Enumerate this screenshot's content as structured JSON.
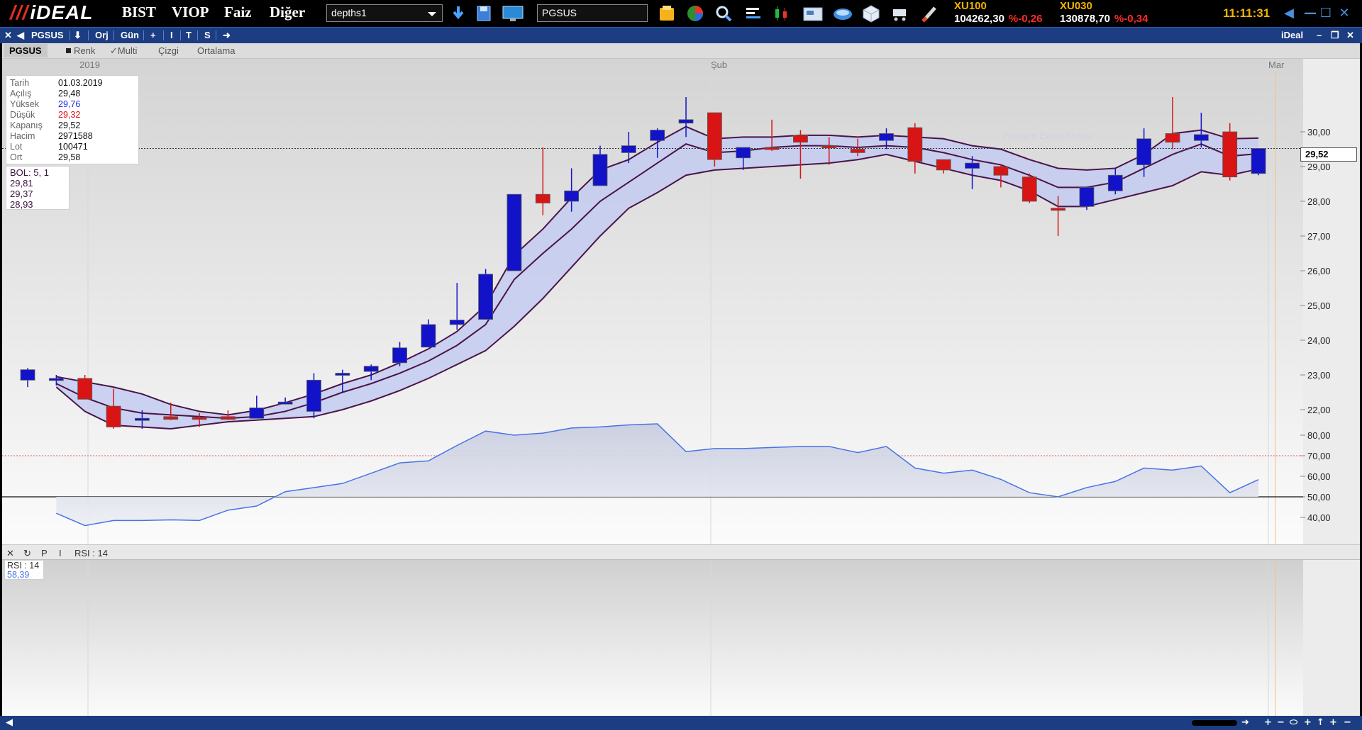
{
  "topbar": {
    "logo": "iDEAL",
    "menu": [
      "BIST",
      "VIOP",
      "Faiz",
      "Diğer"
    ],
    "layout_select": "depths1",
    "symbol_input": "PGSUS",
    "indices": [
      {
        "name": "XU100",
        "value": "104262,30",
        "change": "%-0,26"
      },
      {
        "name": "XU030",
        "value": "130878,70",
        "change": "%-0,34"
      }
    ],
    "clock": "11:11:31",
    "icons": [
      "download-icon",
      "save-icon",
      "monitor-icon",
      "folder-icon",
      "pie-chart-icon",
      "magnifier-icon",
      "depth-icon",
      "candles-icon",
      "news-icon",
      "globe-icon",
      "cube-icon",
      "cart-icon",
      "brush-icon"
    ]
  },
  "titlebar": {
    "symbol": "PGSUS",
    "orj": "Orj",
    "period": "Gün",
    "plus": "+",
    "i": "I",
    "t": "T",
    "s": "S",
    "brand": "iDeal"
  },
  "toolbar": {
    "symbol": "PGSUS",
    "renk": "Renk",
    "multi": "✓Multi",
    "cizgi": "Çizgi",
    "ortalama": "Ortalama"
  },
  "info": {
    "rows": [
      {
        "label": "Tarih",
        "value": "01.03.2019",
        "color": "#111111"
      },
      {
        "label": "Açılış",
        "value": "29,48",
        "color": "#111111"
      },
      {
        "label": "Yüksek",
        "value": "29,76",
        "color": "#1a2ee0"
      },
      {
        "label": "Düşük",
        "value": "29,32",
        "color": "#e01010"
      },
      {
        "label": "Kapanış",
        "value": "29,52",
        "color": "#111111"
      },
      {
        "label": "Hacim",
        "value": "2971588",
        "color": "#111111"
      },
      {
        "label": "Lot",
        "value": "100471",
        "color": "#111111"
      },
      {
        "label": "Ort",
        "value": "29,58",
        "color": "#111111"
      }
    ]
  },
  "bollinger": {
    "title": "BOL: 5, 1",
    "upper": "29,81",
    "mid": "29,37",
    "lower": "28,93"
  },
  "watermark": "Pencere Ekran Alıntısı",
  "last_price": "29,52",
  "rsi": {
    "label": "RSI : 14",
    "box_title": "RSI : 14",
    "value": "58,39",
    "toolbar_icons": [
      "close-icon",
      "refresh-icon",
      "P",
      "I"
    ]
  },
  "colors": {
    "up": "#1212c8",
    "down": "#d81414",
    "band": "#4a1448",
    "band_fill": "#c4cbf0",
    "rsi_line": "#4a72e6"
  },
  "chart_data": {
    "type": "candlestick",
    "symbol": "PGSUS",
    "period_labels": [
      "2019",
      "Şub",
      "Mar"
    ],
    "ylim": [
      21.0,
      31.5
    ],
    "yticks": [
      "22,00",
      "23,00",
      "24,00",
      "25,00",
      "26,00",
      "27,00",
      "28,00",
      "29,00",
      "30,00"
    ],
    "candles": [
      {
        "o": 22.85,
        "h": 23.2,
        "l": 22.65,
        "c": 23.15
      },
      {
        "o": 22.9,
        "h": 23.0,
        "l": 22.7,
        "c": 22.9
      },
      {
        "o": 22.9,
        "h": 23.0,
        "l": 22.35,
        "c": 22.3
      },
      {
        "o": 22.1,
        "h": 22.6,
        "l": 21.45,
        "c": 21.5
      },
      {
        "o": 21.75,
        "h": 21.98,
        "l": 21.45,
        "c": 21.75
      },
      {
        "o": 21.8,
        "h": 22.2,
        "l": 21.7,
        "c": 21.72
      },
      {
        "o": 21.78,
        "h": 21.9,
        "l": 21.5,
        "c": 21.76
      },
      {
        "o": 21.8,
        "h": 21.98,
        "l": 21.7,
        "c": 21.72
      },
      {
        "o": 21.75,
        "h": 22.4,
        "l": 21.75,
        "c": 22.05
      },
      {
        "o": 22.18,
        "h": 22.35,
        "l": 22.15,
        "c": 22.22
      },
      {
        "o": 21.95,
        "h": 23.05,
        "l": 21.75,
        "c": 22.85
      },
      {
        "o": 23.0,
        "h": 23.15,
        "l": 22.5,
        "c": 23.05
      },
      {
        "o": 23.1,
        "h": 23.3,
        "l": 22.85,
        "c": 23.25
      },
      {
        "o": 23.35,
        "h": 23.95,
        "l": 23.25,
        "c": 23.78
      },
      {
        "o": 23.8,
        "h": 24.6,
        "l": 23.8,
        "c": 24.45
      },
      {
        "o": 24.45,
        "h": 25.65,
        "l": 24.3,
        "c": 24.58
      },
      {
        "o": 24.6,
        "h": 26.05,
        "l": 24.6,
        "c": 25.9
      },
      {
        "o": 26.0,
        "h": 28.2,
        "l": 26.0,
        "c": 28.2
      },
      {
        "o": 28.2,
        "h": 29.55,
        "l": 27.6,
        "c": 27.95
      },
      {
        "o": 28.0,
        "h": 28.95,
        "l": 27.7,
        "c": 28.3
      },
      {
        "o": 28.45,
        "h": 29.6,
        "l": 28.45,
        "c": 29.35
      },
      {
        "o": 29.4,
        "h": 30.0,
        "l": 29.1,
        "c": 29.6
      },
      {
        "o": 29.75,
        "h": 30.1,
        "l": 29.25,
        "c": 30.05
      },
      {
        "o": 30.25,
        "h": 31.0,
        "l": 29.85,
        "c": 30.35
      },
      {
        "o": 30.55,
        "h": 30.55,
        "l": 29.0,
        "c": 29.2
      },
      {
        "o": 29.25,
        "h": 29.55,
        "l": 28.9,
        "c": 29.55
      },
      {
        "o": 29.55,
        "h": 30.35,
        "l": 29.45,
        "c": 29.5
      },
      {
        "o": 29.9,
        "h": 30.05,
        "l": 28.65,
        "c": 29.7
      },
      {
        "o": 29.6,
        "h": 29.85,
        "l": 29.05,
        "c": 29.55
      },
      {
        "o": 29.5,
        "h": 29.8,
        "l": 29.3,
        "c": 29.4
      },
      {
        "o": 29.75,
        "h": 30.1,
        "l": 29.5,
        "c": 29.95
      },
      {
        "o": 30.12,
        "h": 30.25,
        "l": 28.8,
        "c": 29.15
      },
      {
        "o": 29.2,
        "h": 29.2,
        "l": 28.8,
        "c": 28.9
      },
      {
        "o": 28.95,
        "h": 29.3,
        "l": 28.35,
        "c": 29.1
      },
      {
        "o": 29.0,
        "h": 29.05,
        "l": 28.4,
        "c": 28.75
      },
      {
        "o": 28.7,
        "h": 28.8,
        "l": 27.95,
        "c": 28.0
      },
      {
        "o": 27.8,
        "h": 28.15,
        "l": 27.0,
        "c": 27.77
      },
      {
        "o": 27.85,
        "h": 28.4,
        "l": 27.75,
        "c": 28.4
      },
      {
        "o": 28.3,
        "h": 28.95,
        "l": 28.2,
        "c": 28.75
      },
      {
        "o": 29.05,
        "h": 30.1,
        "l": 28.7,
        "c": 29.8
      },
      {
        "o": 29.95,
        "h": 31.0,
        "l": 29.5,
        "c": 29.7
      },
      {
        "o": 29.75,
        "h": 30.55,
        "l": 29.55,
        "c": 29.92
      },
      {
        "o": 30.0,
        "h": 30.25,
        "l": 28.6,
        "c": 28.7
      },
      {
        "o": 28.8,
        "h": 29.5,
        "l": 28.75,
        "c": 29.52
      }
    ],
    "bands": {
      "upper": [
        23.0,
        22.95,
        22.8,
        22.65,
        22.45,
        22.15,
        21.95,
        21.85,
        21.98,
        22.2,
        22.45,
        22.75,
        23.0,
        23.35,
        23.75,
        24.25,
        25.0,
        26.45,
        27.2,
        28.1,
        28.9,
        29.2,
        29.7,
        30.15,
        29.8,
        29.85,
        29.85,
        29.9,
        29.9,
        29.85,
        29.9,
        29.85,
        29.8,
        29.6,
        29.5,
        29.2,
        28.95,
        28.9,
        28.95,
        29.35,
        29.95,
        30.05,
        29.8,
        29.82
      ],
      "mid": [
        22.9,
        22.75,
        22.35,
        22.05,
        21.9,
        21.85,
        21.8,
        21.75,
        21.8,
        21.95,
        22.2,
        22.5,
        22.75,
        23.05,
        23.4,
        23.85,
        24.45,
        25.75,
        26.5,
        27.2,
        28.0,
        28.55,
        29.1,
        29.65,
        29.4,
        29.45,
        29.55,
        29.6,
        29.6,
        29.55,
        29.6,
        29.55,
        29.4,
        29.2,
        29.05,
        28.75,
        28.4,
        28.4,
        28.55,
        28.95,
        29.35,
        29.65,
        29.3,
        29.37
      ],
      "lower": [
        22.95,
        22.65,
        21.95,
        21.55,
        21.5,
        21.45,
        21.55,
        21.65,
        21.7,
        21.75,
        21.8,
        22.0,
        22.25,
        22.55,
        22.9,
        23.3,
        23.7,
        24.4,
        25.2,
        26.1,
        27.0,
        27.8,
        28.25,
        28.75,
        28.9,
        28.95,
        29.0,
        29.05,
        29.1,
        29.2,
        29.35,
        29.15,
        28.95,
        28.75,
        28.6,
        28.3,
        27.85,
        27.85,
        28.05,
        28.25,
        28.45,
        28.85,
        28.75,
        28.93
      ]
    },
    "rsi": {
      "ylim": [
        30,
        90
      ],
      "yticks": [
        "40,00",
        "50,00",
        "60,00",
        "70,00",
        "80,00"
      ],
      "overbought": 70,
      "midline": 50,
      "values": [
        46.5,
        42,
        36,
        38.5,
        38.5,
        38.8,
        38.5,
        43.5,
        45.5,
        52.5,
        54.5,
        56.5,
        61.5,
        66.5,
        67.5,
        75,
        82,
        80,
        81,
        83.5,
        84,
        85,
        85.5,
        72,
        73.5,
        73.5,
        74,
        74.5,
        74.5,
        71.5,
        74.5,
        64,
        61.5,
        63,
        58.5,
        52,
        50,
        54.5,
        57.5,
        64,
        63,
        65,
        52,
        58.39
      ]
    }
  }
}
